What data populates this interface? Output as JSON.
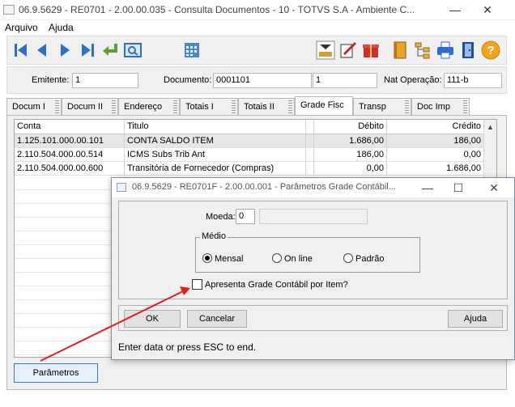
{
  "window": {
    "title": "06.9.5629 - RE0701 - 2.00.00.035 - Consulta Documentos - 10 - TOTVS S.A - Ambiente C...",
    "minimize_glyph": "—",
    "maximize_glyph": "☐",
    "close_glyph": "✕"
  },
  "menu": {
    "arquivo": "Arquivo",
    "ajuda": "Ajuda"
  },
  "toolbar": {
    "icons": [
      "first-icon",
      "prev-icon",
      "next-icon",
      "last-icon",
      "goto-icon",
      "search-icon",
      "calendar-icon",
      "tool-a-icon",
      "tool-b-icon",
      "tool-c-icon",
      "book-icon",
      "tree-icon",
      "printer-icon",
      "exit-icon",
      "help-icon"
    ],
    "help_glyph": "?"
  },
  "header": {
    "emitente_label": "Emitente:",
    "emitente_value": "1",
    "documento_label": "Documento:",
    "documento_value": "0001101",
    "serie_value": "1",
    "natop_label": "Nat Operação:",
    "natop_value": "111-b"
  },
  "tabs": [
    "Docum I",
    "Docum II",
    "Endereço",
    "Totais I",
    "Totais II",
    "Grade Fisc",
    "Transp",
    "Doc Imp"
  ],
  "active_tab": "Grade Fisc",
  "grid": {
    "columns": [
      "Conta",
      "Titulo",
      "Débito",
      "Crédito"
    ],
    "rows": [
      {
        "conta": "1.125.101.000.00.101",
        "titulo": "CONTA SALDO ITEM",
        "debito": "1.686,00",
        "credito": "186,00"
      },
      {
        "conta": "2.110.504.000.00.514",
        "titulo": "ICMS Subs Trib Ant",
        "debito": "186,00",
        "credito": "0,00"
      },
      {
        "conta": "2.110.504.000.00.600",
        "titulo": "Transitória de Fornecedor (Compras)",
        "debito": "0,00",
        "credito": "1.686,00"
      }
    ],
    "scroll_arrow": "▲"
  },
  "parametros_button": "Parâmetros",
  "dialog": {
    "title": "06.9.5629 - RE0701F - 2.00.00.001 - Parâmetros Grade Contábil...",
    "moeda_label": "Moeda:",
    "moeda_value": "0",
    "medio_legend": "Médio",
    "radios": {
      "mensal": "Mensal",
      "online": "On line",
      "padrao": "Padrão"
    },
    "selected_radio": "Mensal",
    "checkbox_label": "Apresenta Grade Contábil por Item?",
    "checkbox_checked": false,
    "ok": "OK",
    "cancelar": "Cancelar",
    "ajuda": "Ajuda",
    "status": "Enter data or press ESC to end."
  },
  "colors": {
    "arrow": "#e0201f",
    "toolbar_blue": "#2c6fcd",
    "focus_border": "#3a79c9"
  }
}
